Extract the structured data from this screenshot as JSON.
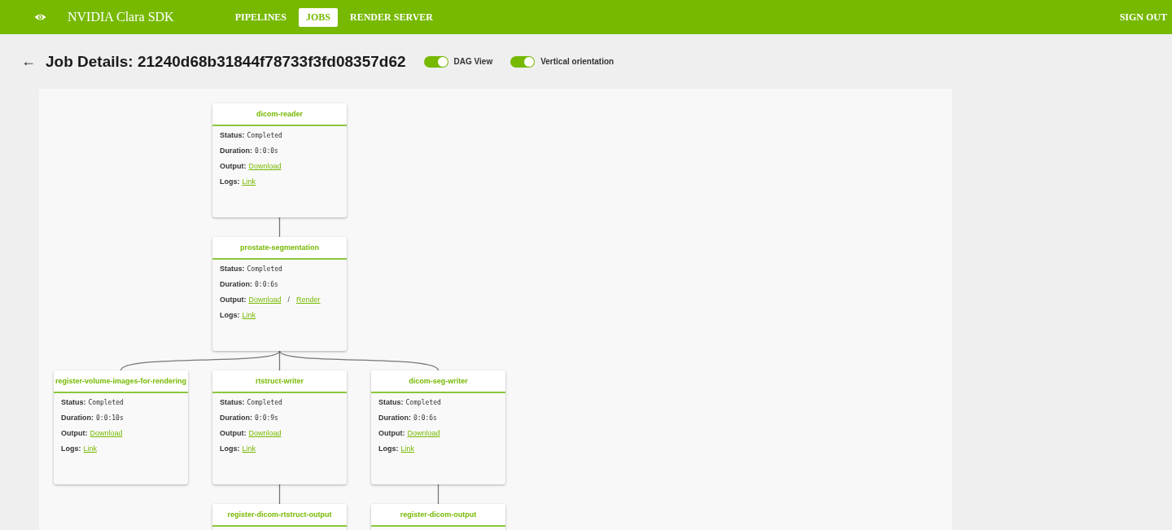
{
  "nav": {
    "brand": "NVIDIA Clara SDK",
    "items": [
      {
        "label": "PIPELINES",
        "selected": false
      },
      {
        "label": "JOBS",
        "selected": true
      },
      {
        "label": "RENDER SERVER",
        "selected": false
      }
    ],
    "sign_out": "SIGN OUT"
  },
  "header": {
    "back": "←",
    "title": "Job Details: 21240d68b31844f78733f3fd08357d62"
  },
  "toggles": [
    {
      "label": "DAG View",
      "on": true
    },
    {
      "label": "Vertical orientation",
      "on": true
    }
  ],
  "dag": {
    "nodes": [
      {
        "title": "dicom-reader",
        "fields": [
          {
            "kind": "text",
            "label": "Status:",
            "value": "Completed"
          },
          {
            "kind": "text",
            "label": "Duration:",
            "value": "0:0:0s"
          },
          {
            "kind": "links",
            "label": "Output:",
            "links": [
              "Download"
            ]
          },
          {
            "kind": "links",
            "label": "Logs:",
            "links": [
              "Link"
            ]
          }
        ],
        "children": [
          {
            "title": "prostate-segmentation",
            "fields": [
              {
                "kind": "text",
                "label": "Status:",
                "value": "Completed"
              },
              {
                "kind": "text",
                "label": "Duration:",
                "value": "0:0:6s"
              },
              {
                "kind": "links",
                "label": "Output:",
                "links": [
                  "Download",
                  "Render"
                ],
                "separator": "/"
              },
              {
                "kind": "links",
                "label": "Logs:",
                "links": [
                  "Link"
                ]
              }
            ],
            "children": [
              {
                "title": "register-volume-images-for-rendering",
                "fields": [
                  {
                    "kind": "text",
                    "label": "Status:",
                    "value": "Completed"
                  },
                  {
                    "kind": "text",
                    "label": "Duration:",
                    "value": "0:0:10s"
                  },
                  {
                    "kind": "links",
                    "label": "Output:",
                    "links": [
                      "Download"
                    ]
                  },
                  {
                    "kind": "links",
                    "label": "Logs:",
                    "links": [
                      "Link"
                    ]
                  }
                ]
              },
              {
                "title": "rtstruct-writer",
                "fields": [
                  {
                    "kind": "text",
                    "label": "Status:",
                    "value": "Completed"
                  },
                  {
                    "kind": "text",
                    "label": "Duration:",
                    "value": "0:0:9s"
                  },
                  {
                    "kind": "links",
                    "label": "Output:",
                    "links": [
                      "Download"
                    ]
                  },
                  {
                    "kind": "links",
                    "label": "Logs:",
                    "links": [
                      "Link"
                    ]
                  }
                ],
                "children": [
                  {
                    "title": "register-dicom-rtstruct-output"
                  }
                ]
              },
              {
                "title": "dicom-seg-writer",
                "fields": [
                  {
                    "kind": "text",
                    "label": "Status:",
                    "value": "Completed"
                  },
                  {
                    "kind": "text",
                    "label": "Duration:",
                    "value": "0:0:6s"
                  },
                  {
                    "kind": "links",
                    "label": "Output:",
                    "links": [
                      "Download"
                    ]
                  },
                  {
                    "kind": "links",
                    "label": "Logs:",
                    "links": [
                      "Link"
                    ]
                  }
                ],
                "children": [
                  {
                    "title": "register-dicom-output"
                  }
                ]
              }
            ]
          }
        ]
      }
    ]
  }
}
